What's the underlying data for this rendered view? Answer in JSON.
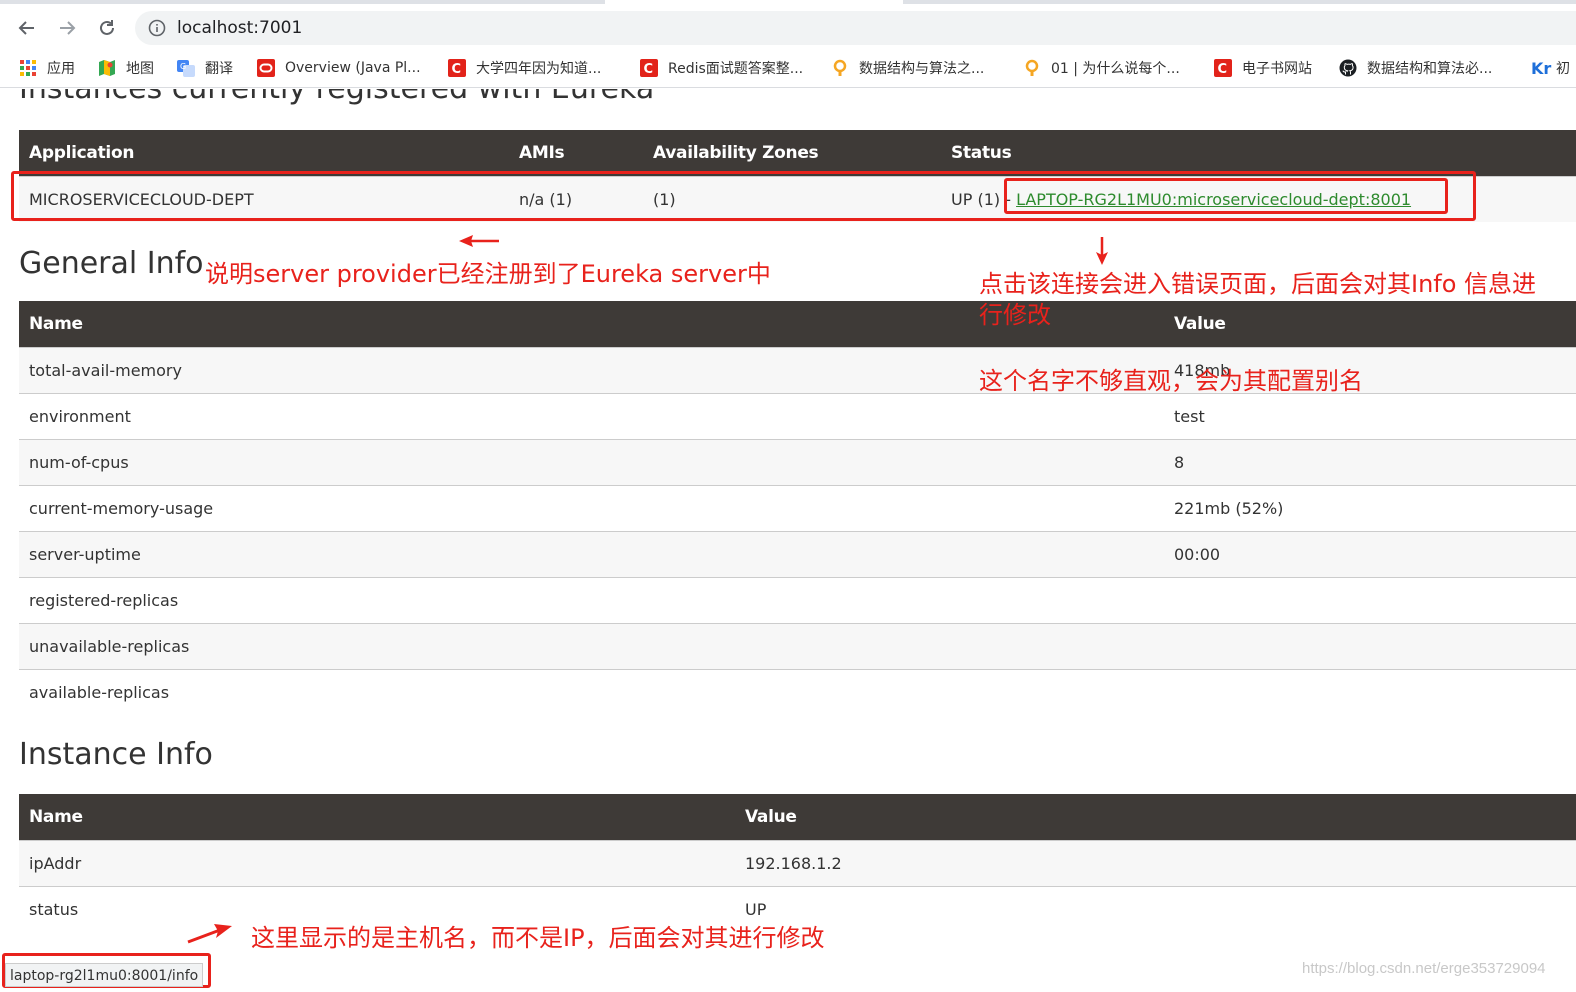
{
  "browser": {
    "url": "localhost:7001",
    "bookmarks": [
      {
        "label": "应用",
        "icon": "apps-grid-icon"
      },
      {
        "label": "地图",
        "icon": "maps-icon"
      },
      {
        "label": "翻译",
        "icon": "translate-icon"
      },
      {
        "label": "Overview (Java Pl...",
        "icon": "oracle-icon"
      },
      {
        "label": "大学四年因为知道...",
        "icon": "csdn-icon"
      },
      {
        "label": "Redis面试题答案整...",
        "icon": "csdn-icon"
      },
      {
        "label": "数据结构与算法之...",
        "icon": "geek-icon"
      },
      {
        "label": "01 | 为什么说每个...",
        "icon": "geek-icon"
      },
      {
        "label": "电子书网站",
        "icon": "csdn-icon"
      },
      {
        "label": "数据结构和算法必...",
        "icon": "github-icon"
      },
      {
        "label": "初",
        "icon": "kr-icon"
      }
    ],
    "status_url": "laptop-rg2l1mu0:8001/info"
  },
  "page": {
    "cut_heading": "Instances currently registered with Eureka",
    "instances_table": {
      "headers": [
        "Application",
        "AMIs",
        "Availability Zones",
        "Status"
      ],
      "row": {
        "application": "MICROSERVICECLOUD-DEPT",
        "amis": "n/a (1)",
        "zones": "(1)",
        "status_prefix": "UP (1) - ",
        "status_link": "LAPTOP-RG2L1MU0:microservicecloud-dept:8001"
      }
    },
    "general_info": {
      "title": "General Info",
      "headers": [
        "Name",
        "Value"
      ],
      "rows": [
        {
          "name": "total-avail-memory",
          "value": "418mb"
        },
        {
          "name": "environment",
          "value": "test"
        },
        {
          "name": "num-of-cpus",
          "value": "8"
        },
        {
          "name": "current-memory-usage",
          "value": "221mb (52%)"
        },
        {
          "name": "server-uptime",
          "value": "00:00"
        },
        {
          "name": "registered-replicas",
          "value": ""
        },
        {
          "name": "unavailable-replicas",
          "value": ""
        },
        {
          "name": "available-replicas",
          "value": ""
        }
      ]
    },
    "instance_info": {
      "title": "Instance Info",
      "headers": [
        "Name",
        "Value"
      ],
      "rows": [
        {
          "name": "ipAddr",
          "value": "192.168.1.2"
        },
        {
          "name": "status",
          "value": "UP"
        }
      ]
    }
  },
  "annotations": {
    "registered_note": "说明server provider已经注册到了Eureka server中",
    "link_note_line1": "点击该连接会进入错误页面，后面会对其Info 信息进",
    "link_note_line2": "行修改",
    "alias_note": "这个名字不够直观，会为其配置别名",
    "hostname_note": "这里显示的是主机名，而不是IP，后面会对其进行修改",
    "color": "#e8221c"
  },
  "watermark": "https://blog.csdn.net/erge353729094"
}
